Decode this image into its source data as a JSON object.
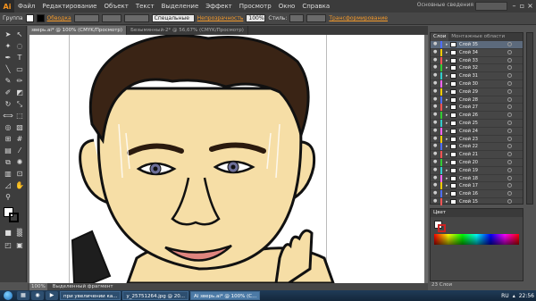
{
  "app": {
    "logo": "Ai",
    "workspace": "Основные сведения"
  },
  "menu": [
    "Файл",
    "Редактирование",
    "Объект",
    "Текст",
    "Выделение",
    "Эффект",
    "Просмотр",
    "Окно",
    "Справка"
  ],
  "controlbar": {
    "group_label": "Группа",
    "stroke_label": "Обводка",
    "style_value": "Спецальные",
    "opacity_label": "Непрозрачность",
    "opacity_value": "100%",
    "styles_label": "Стиль:",
    "transform_label": "Трансформирование"
  },
  "tabs": [
    {
      "label": "зверь.ai* @ 100% (CMYK/Просмотр)",
      "active": true
    },
    {
      "label": "Безымянный-2* @ 56,67% (CMYK/Просмотр)",
      "active": false
    }
  ],
  "status": {
    "zoom": "100%",
    "mode": "Выделенный фрагмент"
  },
  "panels": {
    "layers_tab": "Слои",
    "artboards_tab": "Монтажные области",
    "color_tab": "Цвет",
    "layers_count": "23 Слои"
  },
  "layers": [
    {
      "name": "Слой 35",
      "color": "#4f6fff",
      "selected": true
    },
    {
      "name": "Слой 34",
      "color": "#ffcc00"
    },
    {
      "name": "Слой 33",
      "color": "#ff5555"
    },
    {
      "name": "Слой 32",
      "color": "#33cc33"
    },
    {
      "name": "Слой 31",
      "color": "#33cccc"
    },
    {
      "name": "Слой 30",
      "color": "#ff66ff"
    },
    {
      "name": "Слой 29",
      "color": "#ffcc00"
    },
    {
      "name": "Слой 28",
      "color": "#4f6fff"
    },
    {
      "name": "Слой 27",
      "color": "#ff5555"
    },
    {
      "name": "Слой 26",
      "color": "#33cc33"
    },
    {
      "name": "Слой 25",
      "color": "#33cccc"
    },
    {
      "name": "Слой 24",
      "color": "#ff66ff"
    },
    {
      "name": "Слой 23",
      "color": "#ffcc00"
    },
    {
      "name": "Слой 22",
      "color": "#4f6fff"
    },
    {
      "name": "Слой 21",
      "color": "#ff5555"
    },
    {
      "name": "Слой 20",
      "color": "#33cc33"
    },
    {
      "name": "Слой 19",
      "color": "#33cccc"
    },
    {
      "name": "Слой 18",
      "color": "#ff66ff"
    },
    {
      "name": "Слой 17",
      "color": "#ffcc00"
    },
    {
      "name": "Слой 16",
      "color": "#4f6fff"
    },
    {
      "name": "Слой 15",
      "color": "#ff5555"
    }
  ],
  "taskbar": {
    "tasks": [
      {
        "label": "при увеличении ка...",
        "active": false
      },
      {
        "label": "у_25751264.jpg @ 20...",
        "active": false
      },
      {
        "label": "Ai зверь.ai* @ 100% (C...",
        "active": true
      }
    ],
    "lang": "RU",
    "time": "22:56"
  }
}
